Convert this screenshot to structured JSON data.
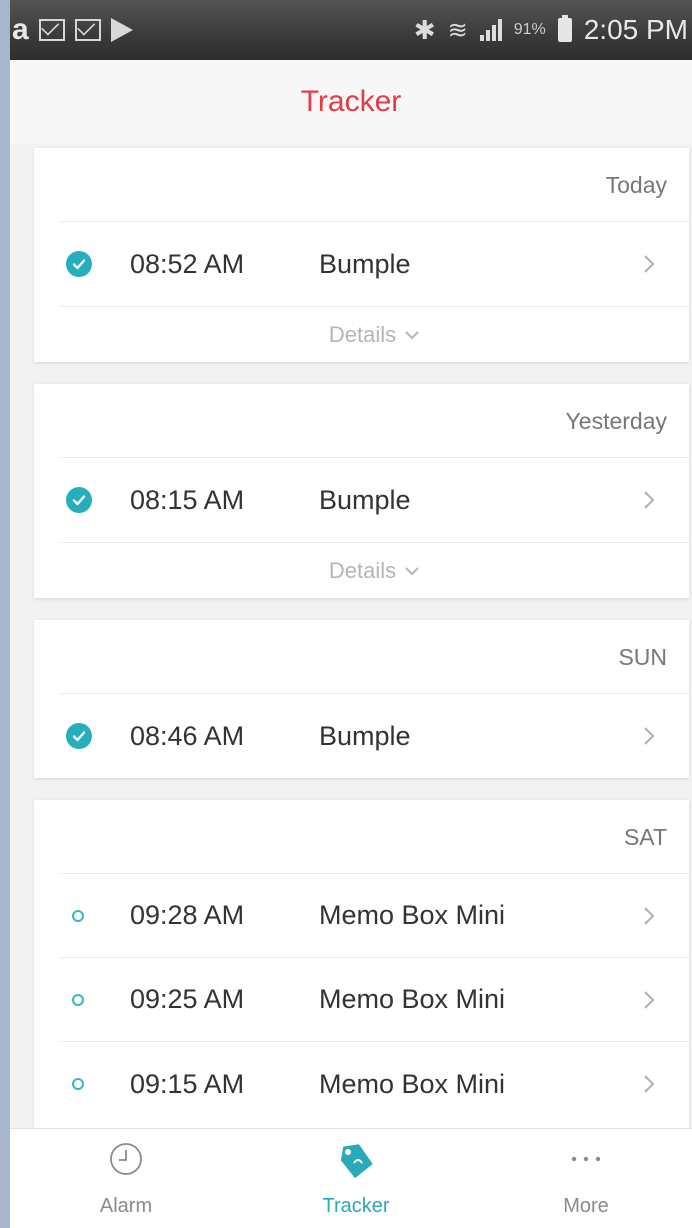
{
  "status_bar": {
    "left_icons": [
      "amazon-icon",
      "mail-icon",
      "mail-icon",
      "play-icon"
    ],
    "battery_percent": "91%",
    "time": "2:05 PM"
  },
  "header": {
    "title": "Tracker"
  },
  "colors": {
    "accent": "#e23b49",
    "teal": "#26aebd",
    "background": "#f2f2f2"
  },
  "details_label": "Details",
  "groups": [
    {
      "day": "Today",
      "entries": [
        {
          "time": "08:52 AM",
          "name": "Bumple",
          "status": "checked"
        }
      ],
      "show_details": true
    },
    {
      "day": "Yesterday",
      "entries": [
        {
          "time": "08:15 AM",
          "name": "Bumple",
          "status": "checked"
        }
      ],
      "show_details": true
    },
    {
      "day": "SUN",
      "entries": [
        {
          "time": "08:46 AM",
          "name": "Bumple",
          "status": "checked"
        }
      ],
      "show_details": false
    },
    {
      "day": "SAT",
      "entries": [
        {
          "time": "09:28 AM",
          "name": "Memo Box Mini",
          "status": "pending"
        },
        {
          "time": "09:25 AM",
          "name": "Memo Box Mini",
          "status": "pending"
        },
        {
          "time": "09:15 AM",
          "name": "Memo Box Mini",
          "status": "pending"
        }
      ],
      "show_details": false
    }
  ],
  "bottom_nav": {
    "tabs": [
      {
        "label": "Alarm",
        "icon": "clock-icon",
        "active": false
      },
      {
        "label": "Tracker",
        "icon": "tag-icon",
        "active": true
      },
      {
        "label": "More",
        "icon": "more-icon",
        "active": false
      }
    ]
  }
}
